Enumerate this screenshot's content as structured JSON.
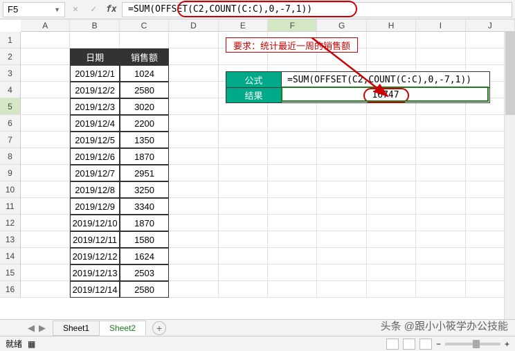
{
  "name_box": "F5",
  "formula": "=SUM(OFFSET(C2,COUNT(C:C),0,-7,1))",
  "columns": [
    "A",
    "B",
    "C",
    "D",
    "E",
    "F",
    "G",
    "H",
    "I",
    "J"
  ],
  "rows": [
    "1",
    "2",
    "3",
    "4",
    "5",
    "6",
    "7",
    "8",
    "9",
    "10",
    "11",
    "12",
    "13",
    "14",
    "15",
    "16"
  ],
  "table": {
    "headers": {
      "date": "日期",
      "sales": "销售额"
    },
    "data": [
      {
        "date": "2019/12/1",
        "sales": "1024"
      },
      {
        "date": "2019/12/2",
        "sales": "2580"
      },
      {
        "date": "2019/12/3",
        "sales": "3020"
      },
      {
        "date": "2019/12/4",
        "sales": "2200"
      },
      {
        "date": "2019/12/5",
        "sales": "1350"
      },
      {
        "date": "2019/12/6",
        "sales": "1870"
      },
      {
        "date": "2019/12/7",
        "sales": "2951"
      },
      {
        "date": "2019/12/8",
        "sales": "3250"
      },
      {
        "date": "2019/12/9",
        "sales": "3340"
      },
      {
        "date": "2019/12/10",
        "sales": "1870"
      },
      {
        "date": "2019/12/11",
        "sales": "1580"
      },
      {
        "date": "2019/12/12",
        "sales": "1624"
      },
      {
        "date": "2019/12/13",
        "sales": "2503"
      },
      {
        "date": "2019/12/14",
        "sales": "2580"
      }
    ]
  },
  "requirement": "要求：统计最近一周的销售额",
  "fr": {
    "formula_label": "公式",
    "formula_value": "=SUM(OFFSET(C2,COUNT(C:C),0,-7,1))",
    "result_label": "结果",
    "result_value": "16747"
  },
  "tabs": {
    "sheet1": "Sheet1",
    "sheet2": "Sheet2"
  },
  "status": {
    "ready": "就绪"
  },
  "watermark": "头条 @跟小小筱学办公技能",
  "icons": {
    "add": "+",
    "minus": "−"
  }
}
